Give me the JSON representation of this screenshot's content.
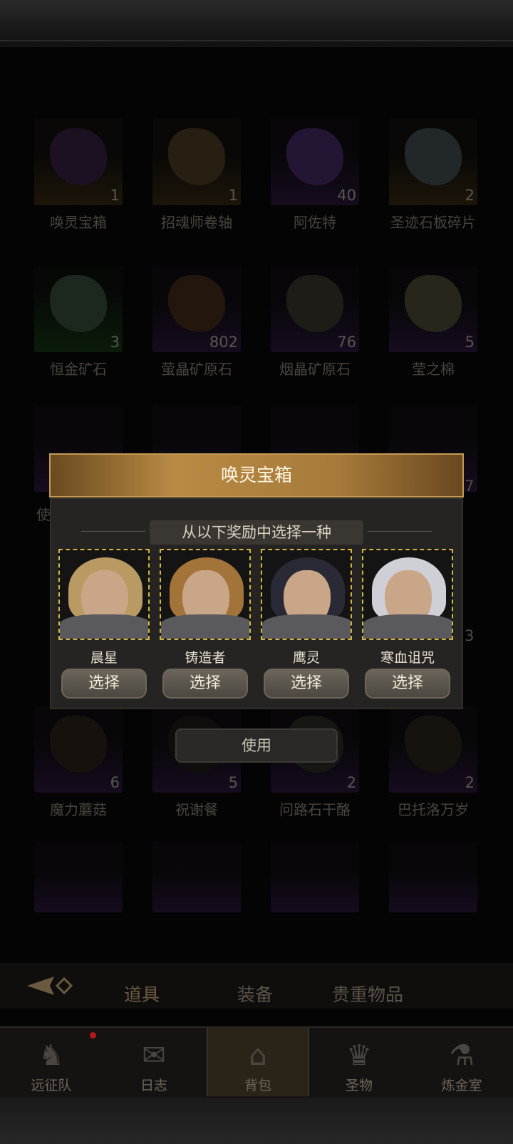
{
  "inventory": {
    "items": [
      {
        "name": "唤灵宝箱",
        "count": "1",
        "rarity": "gold",
        "color": "#4b2e5a"
      },
      {
        "name": "招魂师卷轴",
        "count": "1",
        "rarity": "gold",
        "color": "#6a5232"
      },
      {
        "name": "阿佐特",
        "count": "40",
        "rarity": "purple",
        "color": "#5a3a8a"
      },
      {
        "name": "圣迹石板碎片",
        "count": "2",
        "rarity": "gold",
        "color": "#5a6a6e"
      },
      {
        "name": "恒金矿石",
        "count": "3",
        "rarity": "green",
        "color": "#4a6a50"
      },
      {
        "name": "萤晶矿原石",
        "count": "802",
        "rarity": "purple",
        "color": "#5a3a22"
      },
      {
        "name": "烟晶矿原石",
        "count": "76",
        "rarity": "purple",
        "color": "#4c4a3a"
      },
      {
        "name": "莹之棉",
        "count": "5",
        "rarity": "purple",
        "color": "#6a6448"
      },
      {
        "name": "魔力蘑菇",
        "count": "6",
        "rarity": "purple",
        "color": "#3a2e24"
      },
      {
        "name": "祝谢餐",
        "count": "5",
        "rarity": "purple",
        "color": "#2a2420"
      },
      {
        "name": "问路石干酪",
        "count": "2",
        "rarity": "purple",
        "color": "#3c3a34"
      },
      {
        "name": "巴托洛万岁",
        "count": "2",
        "rarity": "purple",
        "color": "#3a3026"
      }
    ],
    "partial_labels": {
      "row3_left_fragment": "使",
      "row3_right_count": "7",
      "row4_right_count": "3"
    }
  },
  "modal": {
    "title": "唤灵宝箱",
    "prompt": "从以下奖励中选择一种",
    "heroes": [
      {
        "name": "晨星",
        "button": "选择",
        "hair": "#b89a62"
      },
      {
        "name": "铸造者",
        "button": "选择",
        "hair": "#a2743a"
      },
      {
        "name": "鹰灵",
        "button": "选择",
        "hair": "#2a2a36"
      },
      {
        "name": "寒血诅咒",
        "button": "选择",
        "hair": "#cfcfd6"
      }
    ],
    "use_button": "使用"
  },
  "subtabs": [
    "道具",
    "装备",
    "贵重物品"
  ],
  "nav": [
    {
      "label": "远征队",
      "icon": "helmet-icon"
    },
    {
      "label": "日志",
      "icon": "scroll-icon"
    },
    {
      "label": "背包",
      "icon": "backpack-icon"
    },
    {
      "label": "圣物",
      "icon": "chalice-icon"
    },
    {
      "label": "炼金室",
      "icon": "alchemy-icon"
    }
  ],
  "colors": {
    "accent": "#b88a44",
    "selection_border": "#d4b43a",
    "notification": "#b31b1b"
  }
}
